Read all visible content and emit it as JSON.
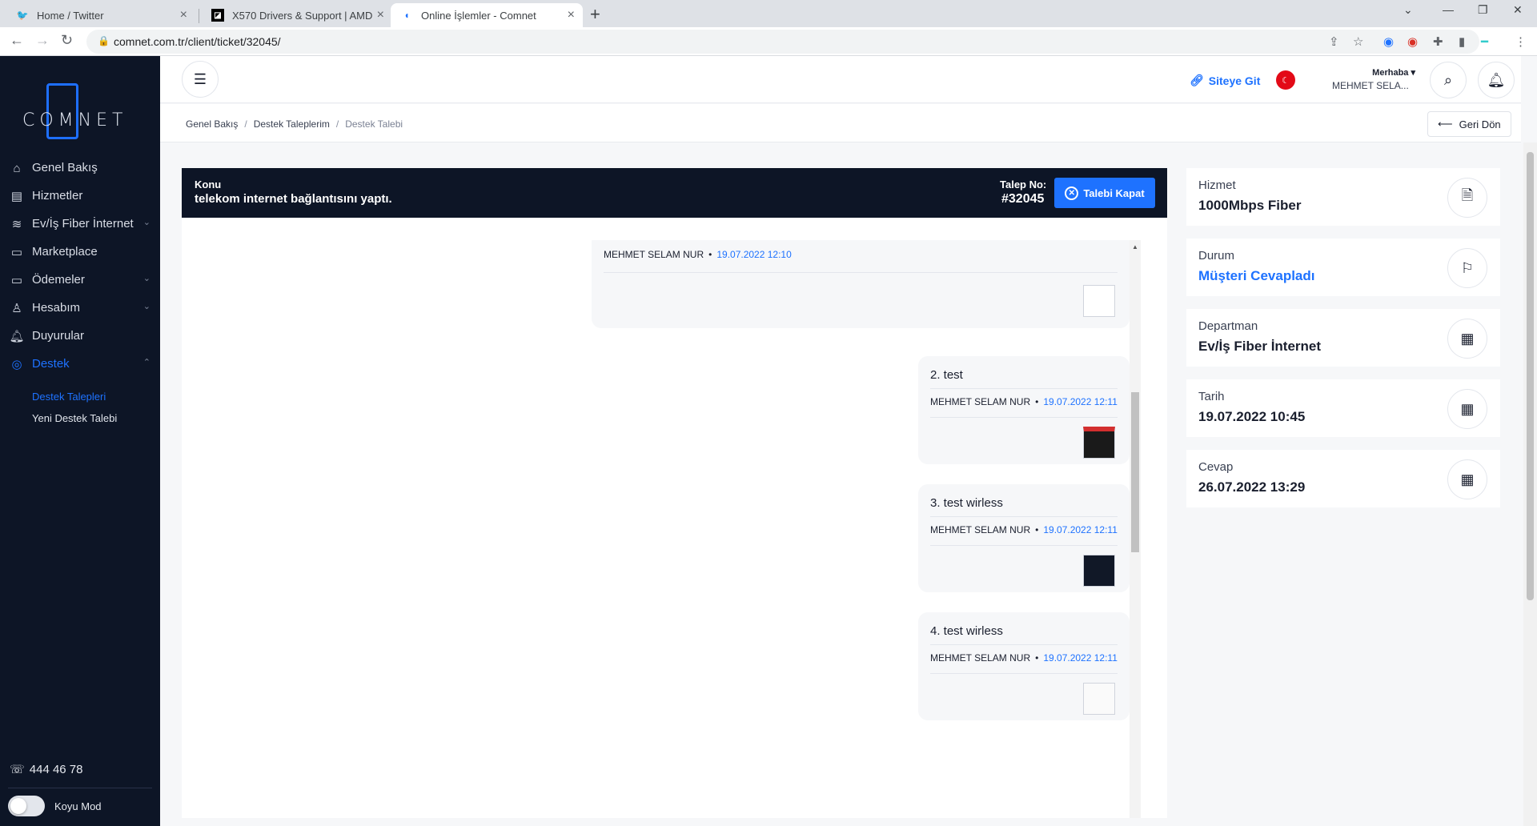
{
  "browser": {
    "tabs": [
      {
        "title": "Home / Twitter",
        "icon": "twitter-icon"
      },
      {
        "title": "X570 Drivers & Support | AMD",
        "icon": "amd-icon"
      },
      {
        "title": "Online İşlemler - Comnet",
        "icon": "comnet-icon"
      }
    ],
    "url": "comnet.com.tr/client/ticket/32045/"
  },
  "sidebar": {
    "logo": "COMNET",
    "menu": [
      {
        "label": "Genel Bakış",
        "icon": "home-icon"
      },
      {
        "label": "Hizmetler",
        "icon": "list-icon"
      },
      {
        "label": "Ev/İş Fiber İnternet",
        "icon": "wifi-icon"
      },
      {
        "label": "Marketplace",
        "icon": "store-icon"
      },
      {
        "label": "Ödemeler",
        "icon": "wallet-icon"
      },
      {
        "label": "Hesabım",
        "icon": "user-icon"
      },
      {
        "label": "Duyurular",
        "icon": "bell-icon"
      },
      {
        "label": "Destek",
        "icon": "lifebuoy-icon"
      }
    ],
    "submenu": [
      "Destek Talepleri",
      "Yeni Destek Talebi"
    ],
    "phone": "444 46 78",
    "dark_mode_label": "Koyu Mod"
  },
  "header": {
    "site_link": "Siteye Git",
    "greeting": "Merhaba",
    "user": "MEHMET SELA..."
  },
  "breadcrumb": [
    "Genel Bakış",
    "Destek Taleplerim",
    "Destek Talebi"
  ],
  "back_label": "Geri Dön",
  "ticket": {
    "subject_label": "Konu",
    "subject": "telekom internet bağlantısını yaptı.",
    "no_label": "Talep No:",
    "no": "#32045",
    "close_label": "Talebi Kapat",
    "messages": [
      {
        "title": "",
        "author": "MEHMET SELAM NUR",
        "time": "19.07.2022 12:10"
      },
      {
        "title": "2. test",
        "author": "MEHMET SELAM NUR",
        "time": "19.07.2022 12:11"
      },
      {
        "title": "3. test wirless",
        "author": "MEHMET SELAM NUR",
        "time": "19.07.2022 12:11"
      },
      {
        "title": "4. test wirless",
        "author": "MEHMET SELAM NUR",
        "time": "19.07.2022 12:11"
      }
    ]
  },
  "info": [
    {
      "label": "Hizmet",
      "value": "1000Mbps Fiber",
      "icon": "document-icon"
    },
    {
      "label": "Durum",
      "value": "Müşteri Cevapladı",
      "icon": "flag-icon"
    },
    {
      "label": "Departman",
      "value": "Ev/İş Fiber İnternet",
      "icon": "building-icon"
    },
    {
      "label": "Tarih",
      "value": "19.07.2022 10:45",
      "icon": "calendar-icon"
    },
    {
      "label": "Cevap",
      "value": "26.07.2022 13:29",
      "icon": "calendar-check-icon"
    }
  ],
  "colors": {
    "accent": "#1e72ff",
    "sidebar": "#0d1526",
    "flag": "#e30a17"
  }
}
